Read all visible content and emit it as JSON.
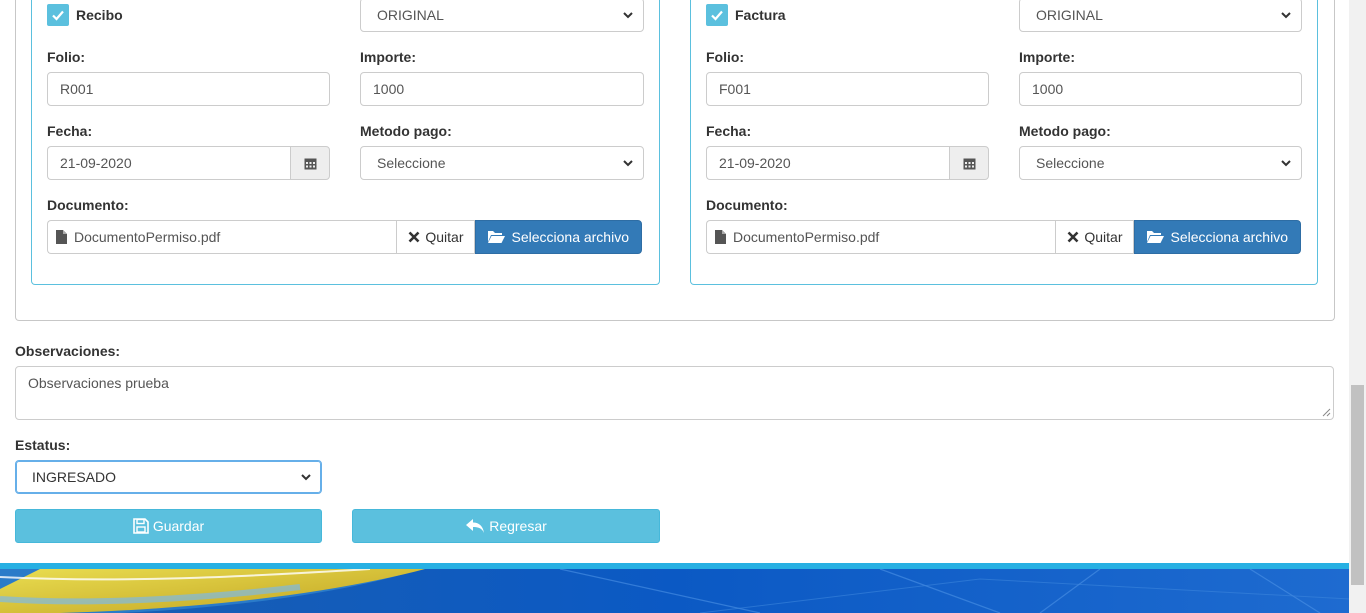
{
  "recibo": {
    "checkbox_label": "Recibo",
    "checked": true,
    "copy_type": "ORIGINAL",
    "folio_label": "Folio:",
    "folio_value": "R001",
    "importe_label": "Importe:",
    "importe_value": "1000",
    "fecha_label": "Fecha:",
    "fecha_value": "21-09-2020",
    "metodo_label": "Metodo pago:",
    "metodo_value": "Seleccione",
    "documento_label": "Documento:",
    "documento_file": "DocumentoPermiso.pdf",
    "quitar_label": "Quitar",
    "browse_label": "Selecciona archivo"
  },
  "factura": {
    "checkbox_label": "Factura",
    "checked": true,
    "copy_type": "ORIGINAL",
    "folio_label": "Folio:",
    "folio_value": "F001",
    "importe_label": "Importe:",
    "importe_value": "1000",
    "fecha_label": "Fecha:",
    "fecha_value": "21-09-2020",
    "metodo_label": "Metodo pago:",
    "metodo_value": "Seleccione",
    "documento_label": "Documento:",
    "documento_file": "DocumentoPermiso.pdf",
    "quitar_label": "Quitar",
    "browse_label": "Selecciona archivo"
  },
  "observaciones": {
    "label": "Observaciones:",
    "value": "Observaciones prueba"
  },
  "estatus": {
    "label": "Estatus:",
    "value": "INGRESADO"
  },
  "actions": {
    "guardar_label": "Guardar",
    "regresar_label": "Regresar"
  },
  "colors": {
    "info": "#5bc0de",
    "primary": "#337ab7",
    "panel_border": "#5bc0de",
    "footer_line": "#27b0e3"
  },
  "icons": {
    "checkbox": "check-icon",
    "select_caret": "chevron-down-icon",
    "date": "calendar-icon",
    "file": "file-icon",
    "remove": "close-icon",
    "browse": "folder-open-icon",
    "save": "floppy-disk-icon",
    "back": "reply-icon"
  }
}
